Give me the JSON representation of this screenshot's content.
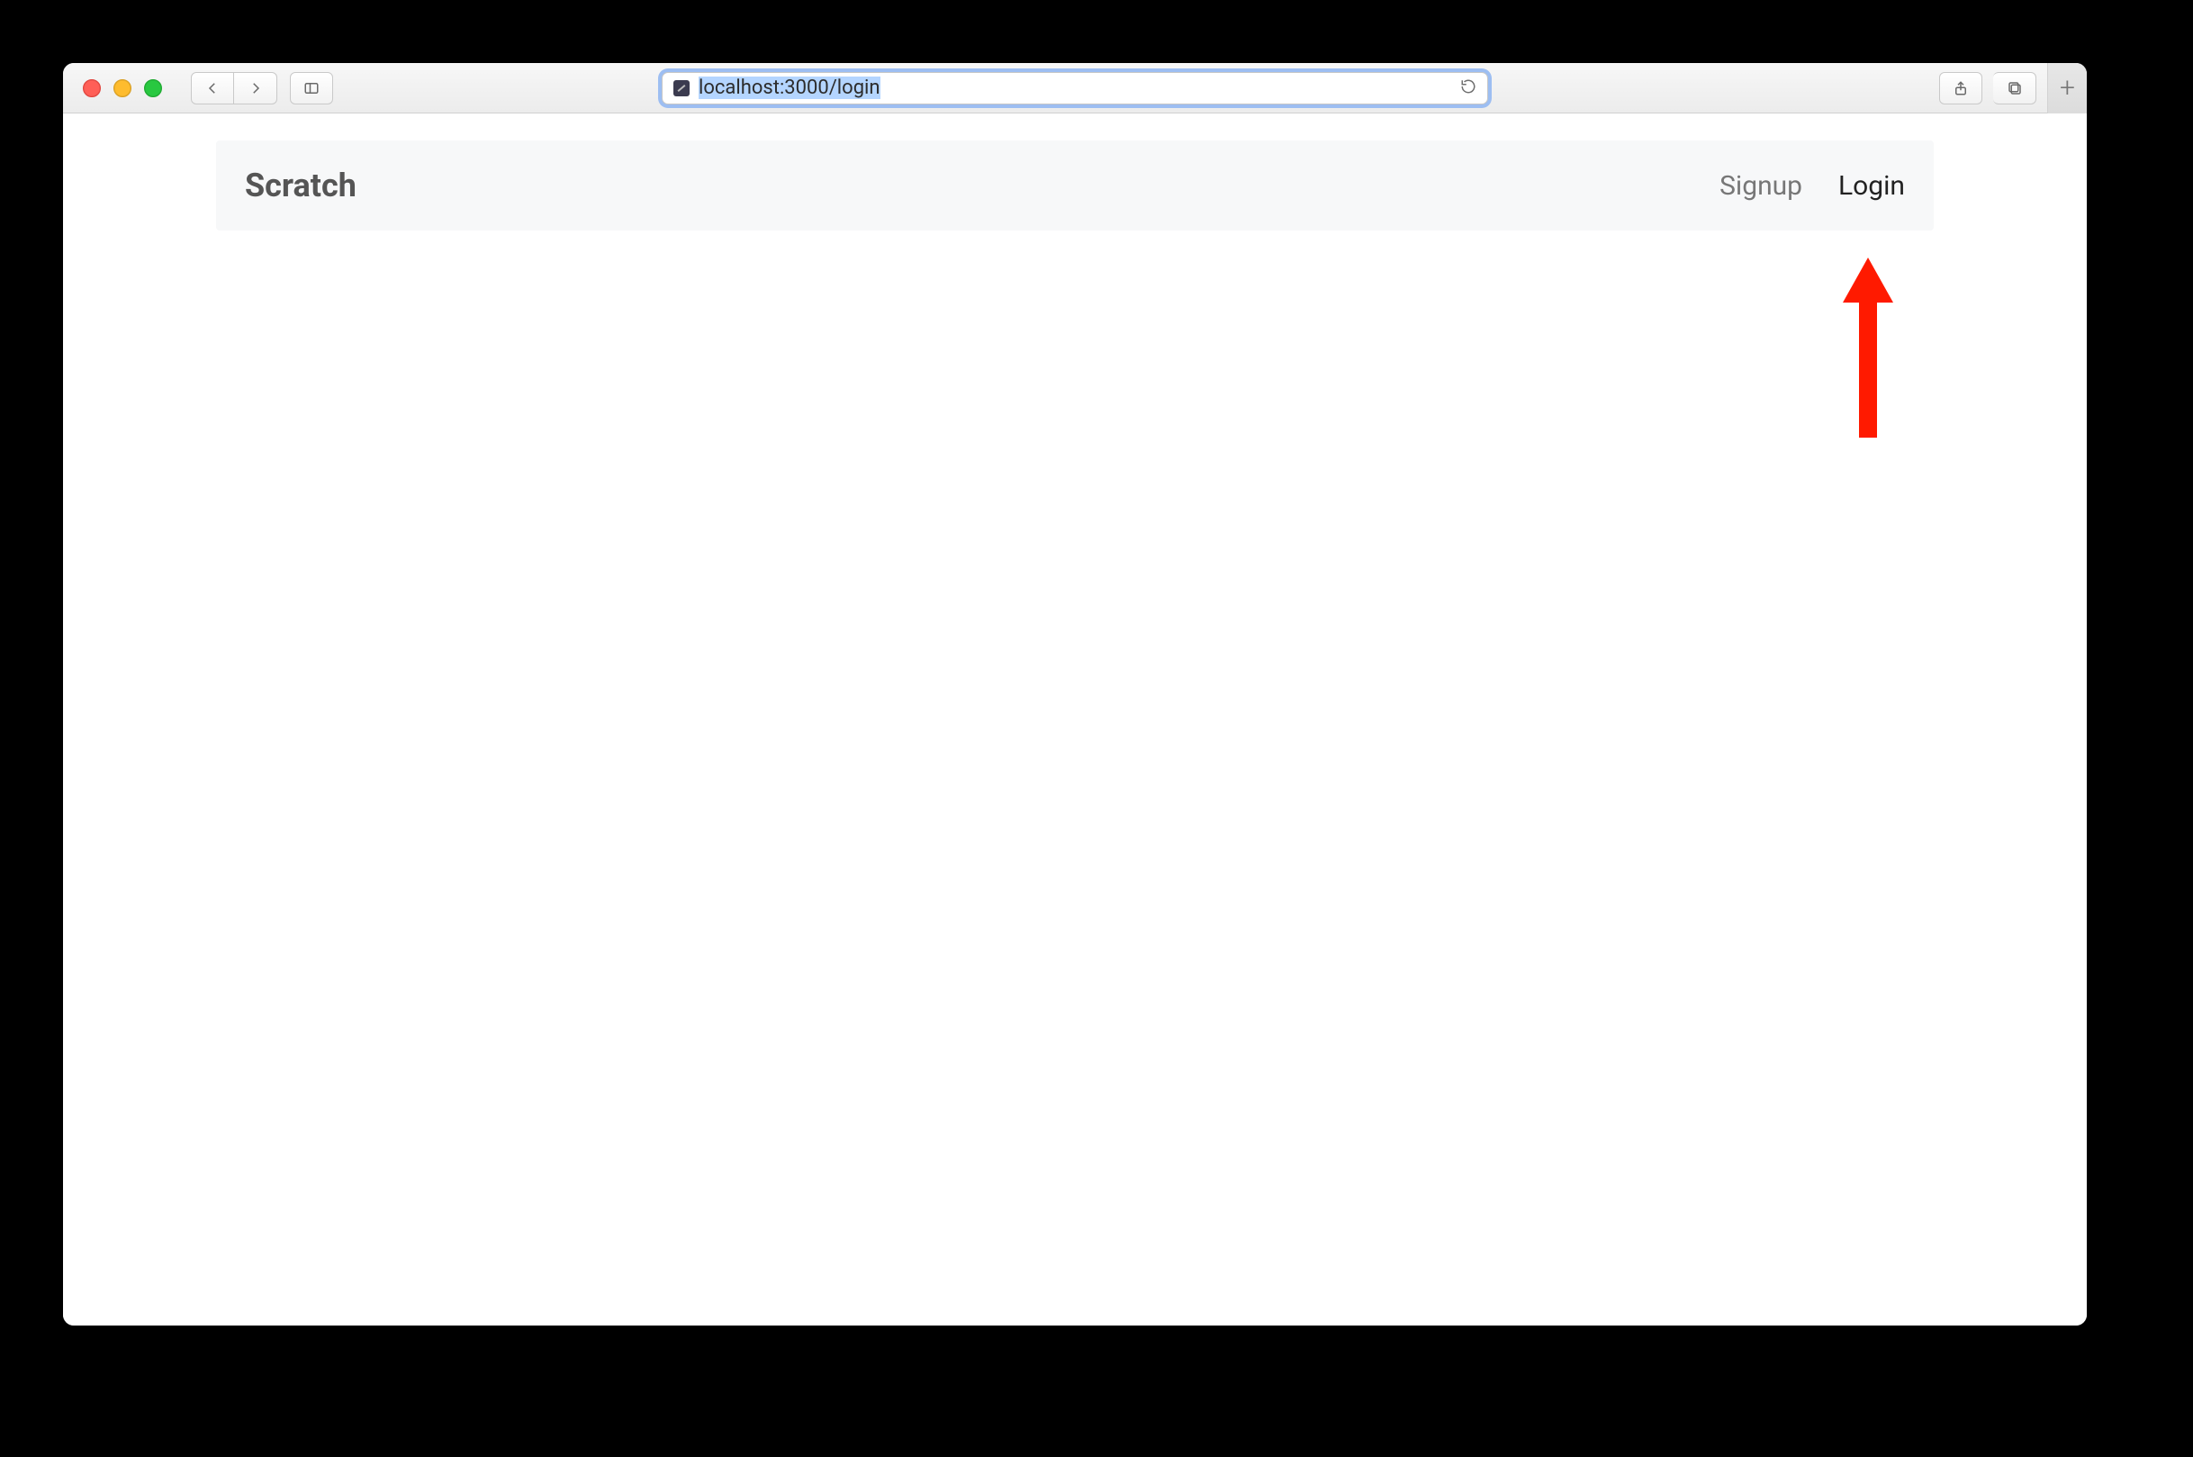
{
  "browser": {
    "url": "localhost:3000/login"
  },
  "app": {
    "brand": "Scratch",
    "nav": {
      "signup": "Signup",
      "login": "Login"
    }
  }
}
